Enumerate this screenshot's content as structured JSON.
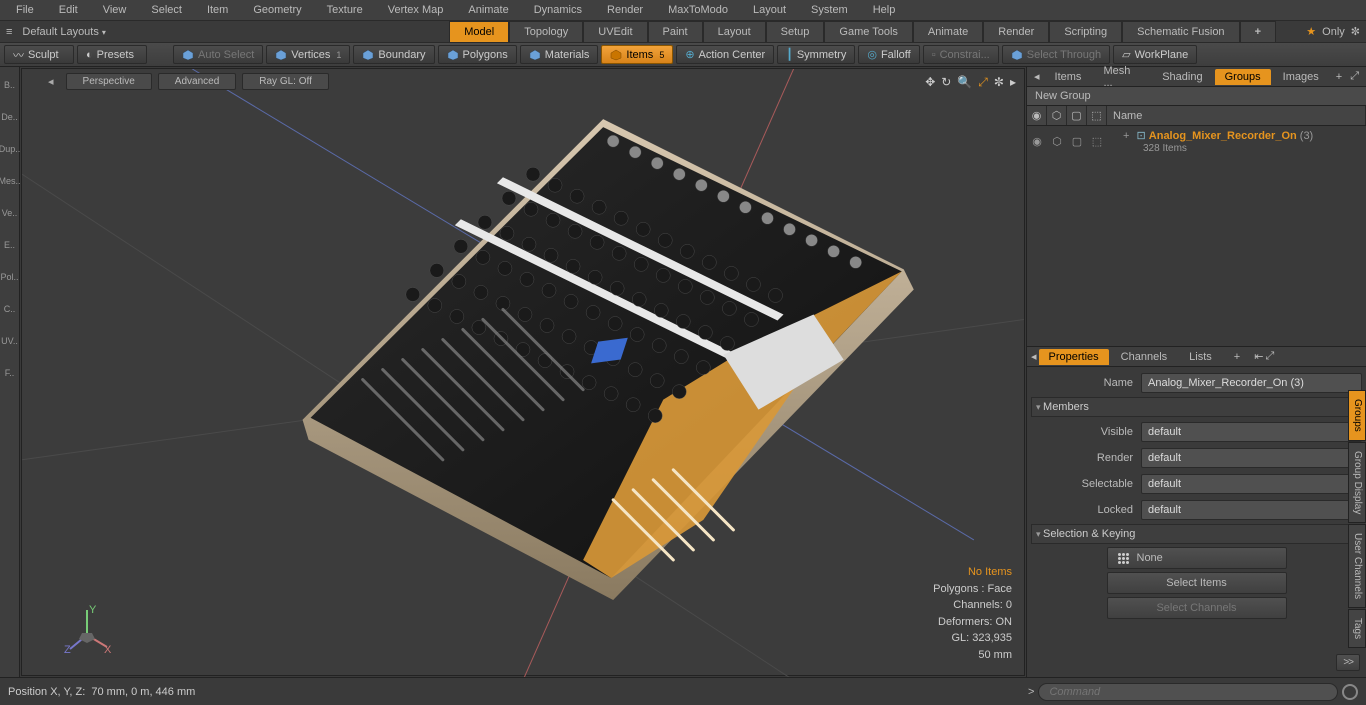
{
  "menu": [
    "File",
    "Edit",
    "View",
    "Select",
    "Item",
    "Geometry",
    "Texture",
    "Vertex Map",
    "Animate",
    "Dynamics",
    "Render",
    "MaxToModo",
    "Layout",
    "System",
    "Help"
  ],
  "layoutbar": {
    "dropdown": "Default Layouts",
    "tabs": [
      "Model",
      "Topology",
      "UVEdit",
      "Paint",
      "Layout",
      "Setup",
      "Game Tools",
      "Animate",
      "Render",
      "Scripting",
      "Schematic Fusion"
    ],
    "active_tab": "Model",
    "only": "Only"
  },
  "toolbar": {
    "sculpt": "Sculpt",
    "presets": "Presets",
    "items": [
      {
        "label": "Auto Select",
        "dim": true
      },
      {
        "label": "Vertices",
        "extra": "1"
      },
      {
        "label": "Boundary"
      },
      {
        "label": "Polygons"
      },
      {
        "label": "Materials"
      },
      {
        "label": "Items",
        "active": true,
        "extra": "5"
      },
      {
        "label": "Action Center"
      },
      {
        "label": "Symmetry"
      },
      {
        "label": "Falloff"
      },
      {
        "label": "Constrai...",
        "dim": true
      },
      {
        "label": "Select Through",
        "dim": true
      },
      {
        "label": "WorkPlane"
      }
    ]
  },
  "viewport": {
    "pills": [
      "Perspective",
      "Advanced",
      "Ray GL: Off"
    ],
    "overlay": {
      "noitems": "No Items",
      "lines": [
        "Polygons : Face",
        "Channels: 0",
        "Deformers: ON",
        "GL: 323,935",
        "50 mm"
      ]
    }
  },
  "leftbar": [
    "B..",
    "De..",
    "Dup..",
    "Mes..",
    "Ve..",
    "E..",
    "Pol..",
    "C..",
    "UV..",
    "F.."
  ],
  "right": {
    "top_tabs": [
      "Items",
      "Mesh ...",
      "Shading",
      "Groups",
      "Images"
    ],
    "top_active": "Groups",
    "newgroup": "New Group",
    "name_col": "Name",
    "item_name": "Analog_Mixer_Recorder_On",
    "item_suffix": "(3)",
    "item_sub": "328 Items",
    "prop_tabs": [
      "Properties",
      "Channels",
      "Lists"
    ],
    "prop_active": "Properties",
    "name_label": "Name",
    "name_value": "Analog_Mixer_Recorder_On (3)",
    "sections": {
      "members": "Members",
      "selkey": "Selection & Keying"
    },
    "rows": [
      {
        "label": "Visible",
        "value": "default"
      },
      {
        "label": "Render",
        "value": "default"
      },
      {
        "label": "Selectable",
        "value": "default"
      },
      {
        "label": "Locked",
        "value": "default"
      }
    ],
    "none": "None",
    "sel_items": "Select Items",
    "sel_channels": "Select Channels"
  },
  "side_tabs": [
    "Groups",
    "Group Display",
    "User Channels",
    "Tags"
  ],
  "status": {
    "pos_label": "Position X, Y, Z:",
    "pos_value": "70 mm, 0 m, 446 mm",
    "cmd_placeholder": "Command"
  }
}
